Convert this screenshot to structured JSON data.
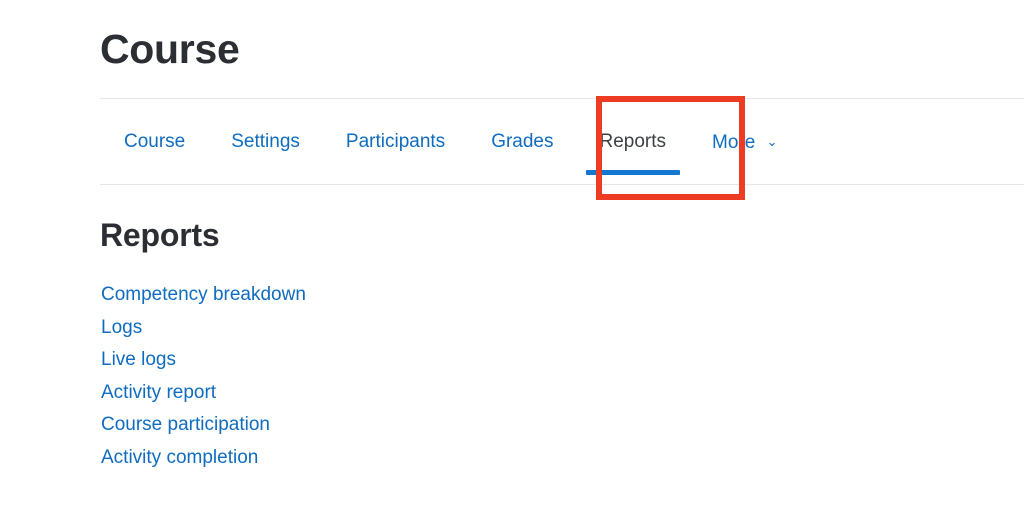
{
  "page": {
    "title": "Course",
    "background_color": "#ffffff",
    "heading_color": "#2b2f33",
    "link_color": "#0f6cbf",
    "accent_color": "#1177d1",
    "annotation_color": "#ee3b24",
    "divider_color": "#e3e7ec"
  },
  "nav": {
    "tabs": [
      {
        "label": "Course",
        "active": false
      },
      {
        "label": "Settings",
        "active": false
      },
      {
        "label": "Participants",
        "active": false
      },
      {
        "label": "Grades",
        "active": false
      },
      {
        "label": "Reports",
        "active": true
      },
      {
        "label": "More",
        "active": false,
        "icon": "chevron-down-icon",
        "chevron": "⌄"
      }
    ]
  },
  "annotation": {
    "target": "Reports",
    "shape": "rectangle",
    "color": "#ee3b24"
  },
  "main": {
    "heading": "Reports",
    "links": [
      {
        "label": "Competency breakdown"
      },
      {
        "label": "Logs"
      },
      {
        "label": "Live logs"
      },
      {
        "label": "Activity report"
      },
      {
        "label": "Course participation"
      },
      {
        "label": "Activity completion"
      }
    ]
  }
}
